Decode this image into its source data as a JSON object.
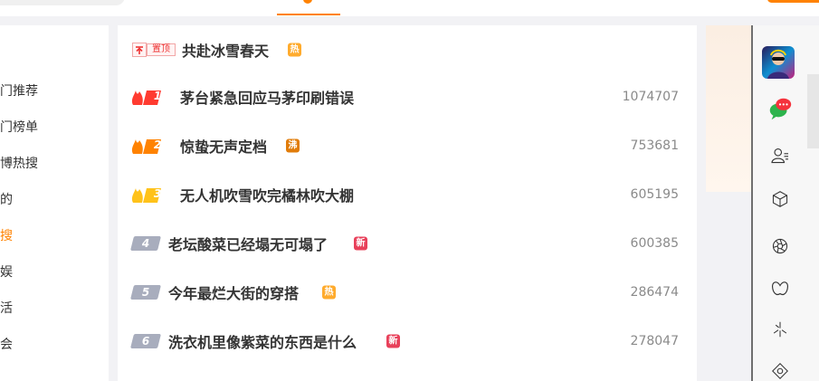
{
  "sidebar": {
    "items": [
      {
        "label": "门推荐",
        "active": false
      },
      {
        "label": "门榜单",
        "active": false
      },
      {
        "label": "博热搜",
        "active": false
      },
      {
        "label": "的",
        "active": false
      },
      {
        "label": "搜",
        "active": true
      },
      {
        "label": "娱",
        "active": false
      },
      {
        "label": "活",
        "active": false
      },
      {
        "label": "会",
        "active": false
      }
    ]
  },
  "hot_list": {
    "pinned": {
      "pin_label": "置顶",
      "title": "共赴冰雪春天",
      "badge": "热"
    },
    "rows": [
      {
        "rank": "1",
        "title": "茅台紧急回应马茅印刷错误",
        "badge": "",
        "count": "1074707",
        "rank_color": "#ff3b30"
      },
      {
        "rank": "2",
        "title": "惊蛰无声定档",
        "badge": "沸",
        "count": "753681",
        "rank_color": "#ff8200"
      },
      {
        "rank": "3",
        "title": "无人机吹雪吹完橘林吹大棚",
        "badge": "",
        "count": "605195",
        "rank_color": "#ffc21a"
      },
      {
        "rank": "4",
        "title": "老坛酸菜已经塌无可塌了",
        "badge": "新",
        "count": "600385"
      },
      {
        "rank": "5",
        "title": "今年最烂大街的穿搭",
        "badge": "热",
        "count": "286474"
      },
      {
        "rank": "6",
        "title": "洗衣机里像紫菜的东西是什么",
        "badge": "新",
        "count": "278047"
      }
    ]
  },
  "right_panel": {
    "icons": [
      "avatar",
      "chat-icon",
      "contacts-icon",
      "cube-icon",
      "aperture-icon",
      "butterfly-icon",
      "sparkle-icon",
      "settings-icon"
    ],
    "chat_badge": "..."
  },
  "colors": {
    "accent": "#ff8200",
    "hot": "#ffab2d",
    "boil": "#e17c0a",
    "new": "#e8405a"
  }
}
